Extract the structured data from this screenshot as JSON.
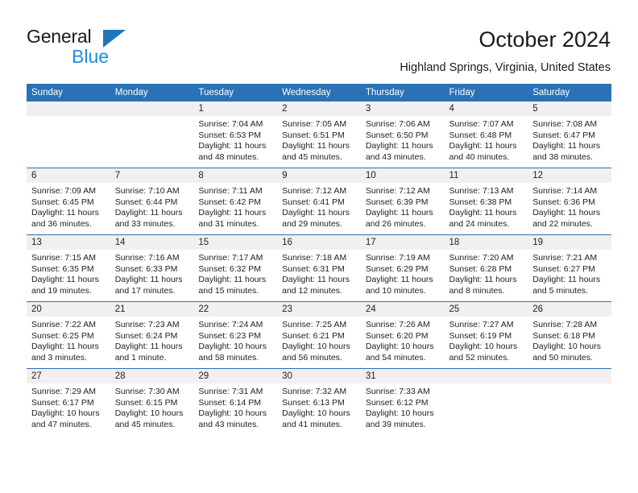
{
  "brand": {
    "name_top": "General",
    "name_bottom": "Blue",
    "triangle_color": "#1e76bd",
    "blue_text_color": "#1e8fe0"
  },
  "header": {
    "title": "October 2024",
    "location": "Highland Springs, Virginia, United States"
  },
  "theme": {
    "header_blue": "#2a72b5",
    "daynum_gray": "#f0f0f0",
    "text": "#222222"
  },
  "calendar": {
    "weekday_headers": [
      "Sunday",
      "Monday",
      "Tuesday",
      "Wednesday",
      "Thursday",
      "Friday",
      "Saturday"
    ],
    "labels": {
      "sunrise": "Sunrise:",
      "sunset": "Sunset:",
      "daylight": "Daylight:"
    },
    "weeks": [
      [
        {
          "day": "",
          "blank": true
        },
        {
          "day": "",
          "blank": true
        },
        {
          "day": "1",
          "sunrise": "Sunrise: 7:04 AM",
          "sunset": "Sunset: 6:53 PM",
          "daylight": "Daylight: 11 hours and 48 minutes."
        },
        {
          "day": "2",
          "sunrise": "Sunrise: 7:05 AM",
          "sunset": "Sunset: 6:51 PM",
          "daylight": "Daylight: 11 hours and 45 minutes."
        },
        {
          "day": "3",
          "sunrise": "Sunrise: 7:06 AM",
          "sunset": "Sunset: 6:50 PM",
          "daylight": "Daylight: 11 hours and 43 minutes."
        },
        {
          "day": "4",
          "sunrise": "Sunrise: 7:07 AM",
          "sunset": "Sunset: 6:48 PM",
          "daylight": "Daylight: 11 hours and 40 minutes."
        },
        {
          "day": "5",
          "sunrise": "Sunrise: 7:08 AM",
          "sunset": "Sunset: 6:47 PM",
          "daylight": "Daylight: 11 hours and 38 minutes."
        }
      ],
      [
        {
          "day": "6",
          "sunrise": "Sunrise: 7:09 AM",
          "sunset": "Sunset: 6:45 PM",
          "daylight": "Daylight: 11 hours and 36 minutes."
        },
        {
          "day": "7",
          "sunrise": "Sunrise: 7:10 AM",
          "sunset": "Sunset: 6:44 PM",
          "daylight": "Daylight: 11 hours and 33 minutes."
        },
        {
          "day": "8",
          "sunrise": "Sunrise: 7:11 AM",
          "sunset": "Sunset: 6:42 PM",
          "daylight": "Daylight: 11 hours and 31 minutes."
        },
        {
          "day": "9",
          "sunrise": "Sunrise: 7:12 AM",
          "sunset": "Sunset: 6:41 PM",
          "daylight": "Daylight: 11 hours and 29 minutes."
        },
        {
          "day": "10",
          "sunrise": "Sunrise: 7:12 AM",
          "sunset": "Sunset: 6:39 PM",
          "daylight": "Daylight: 11 hours and 26 minutes."
        },
        {
          "day": "11",
          "sunrise": "Sunrise: 7:13 AM",
          "sunset": "Sunset: 6:38 PM",
          "daylight": "Daylight: 11 hours and 24 minutes."
        },
        {
          "day": "12",
          "sunrise": "Sunrise: 7:14 AM",
          "sunset": "Sunset: 6:36 PM",
          "daylight": "Daylight: 11 hours and 22 minutes."
        }
      ],
      [
        {
          "day": "13",
          "sunrise": "Sunrise: 7:15 AM",
          "sunset": "Sunset: 6:35 PM",
          "daylight": "Daylight: 11 hours and 19 minutes."
        },
        {
          "day": "14",
          "sunrise": "Sunrise: 7:16 AM",
          "sunset": "Sunset: 6:33 PM",
          "daylight": "Daylight: 11 hours and 17 minutes."
        },
        {
          "day": "15",
          "sunrise": "Sunrise: 7:17 AM",
          "sunset": "Sunset: 6:32 PM",
          "daylight": "Daylight: 11 hours and 15 minutes."
        },
        {
          "day": "16",
          "sunrise": "Sunrise: 7:18 AM",
          "sunset": "Sunset: 6:31 PM",
          "daylight": "Daylight: 11 hours and 12 minutes."
        },
        {
          "day": "17",
          "sunrise": "Sunrise: 7:19 AM",
          "sunset": "Sunset: 6:29 PM",
          "daylight": "Daylight: 11 hours and 10 minutes."
        },
        {
          "day": "18",
          "sunrise": "Sunrise: 7:20 AM",
          "sunset": "Sunset: 6:28 PM",
          "daylight": "Daylight: 11 hours and 8 minutes."
        },
        {
          "day": "19",
          "sunrise": "Sunrise: 7:21 AM",
          "sunset": "Sunset: 6:27 PM",
          "daylight": "Daylight: 11 hours and 5 minutes."
        }
      ],
      [
        {
          "day": "20",
          "sunrise": "Sunrise: 7:22 AM",
          "sunset": "Sunset: 6:25 PM",
          "daylight": "Daylight: 11 hours and 3 minutes."
        },
        {
          "day": "21",
          "sunrise": "Sunrise: 7:23 AM",
          "sunset": "Sunset: 6:24 PM",
          "daylight": "Daylight: 11 hours and 1 minute."
        },
        {
          "day": "22",
          "sunrise": "Sunrise: 7:24 AM",
          "sunset": "Sunset: 6:23 PM",
          "daylight": "Daylight: 10 hours and 58 minutes."
        },
        {
          "day": "23",
          "sunrise": "Sunrise: 7:25 AM",
          "sunset": "Sunset: 6:21 PM",
          "daylight": "Daylight: 10 hours and 56 minutes."
        },
        {
          "day": "24",
          "sunrise": "Sunrise: 7:26 AM",
          "sunset": "Sunset: 6:20 PM",
          "daylight": "Daylight: 10 hours and 54 minutes."
        },
        {
          "day": "25",
          "sunrise": "Sunrise: 7:27 AM",
          "sunset": "Sunset: 6:19 PM",
          "daylight": "Daylight: 10 hours and 52 minutes."
        },
        {
          "day": "26",
          "sunrise": "Sunrise: 7:28 AM",
          "sunset": "Sunset: 6:18 PM",
          "daylight": "Daylight: 10 hours and 50 minutes."
        }
      ],
      [
        {
          "day": "27",
          "sunrise": "Sunrise: 7:29 AM",
          "sunset": "Sunset: 6:17 PM",
          "daylight": "Daylight: 10 hours and 47 minutes."
        },
        {
          "day": "28",
          "sunrise": "Sunrise: 7:30 AM",
          "sunset": "Sunset: 6:15 PM",
          "daylight": "Daylight: 10 hours and 45 minutes."
        },
        {
          "day": "29",
          "sunrise": "Sunrise: 7:31 AM",
          "sunset": "Sunset: 6:14 PM",
          "daylight": "Daylight: 10 hours and 43 minutes."
        },
        {
          "day": "30",
          "sunrise": "Sunrise: 7:32 AM",
          "sunset": "Sunset: 6:13 PM",
          "daylight": "Daylight: 10 hours and 41 minutes."
        },
        {
          "day": "31",
          "sunrise": "Sunrise: 7:33 AM",
          "sunset": "Sunset: 6:12 PM",
          "daylight": "Daylight: 10 hours and 39 minutes."
        },
        {
          "day": "",
          "blank": true
        },
        {
          "day": "",
          "blank": true
        }
      ]
    ]
  }
}
